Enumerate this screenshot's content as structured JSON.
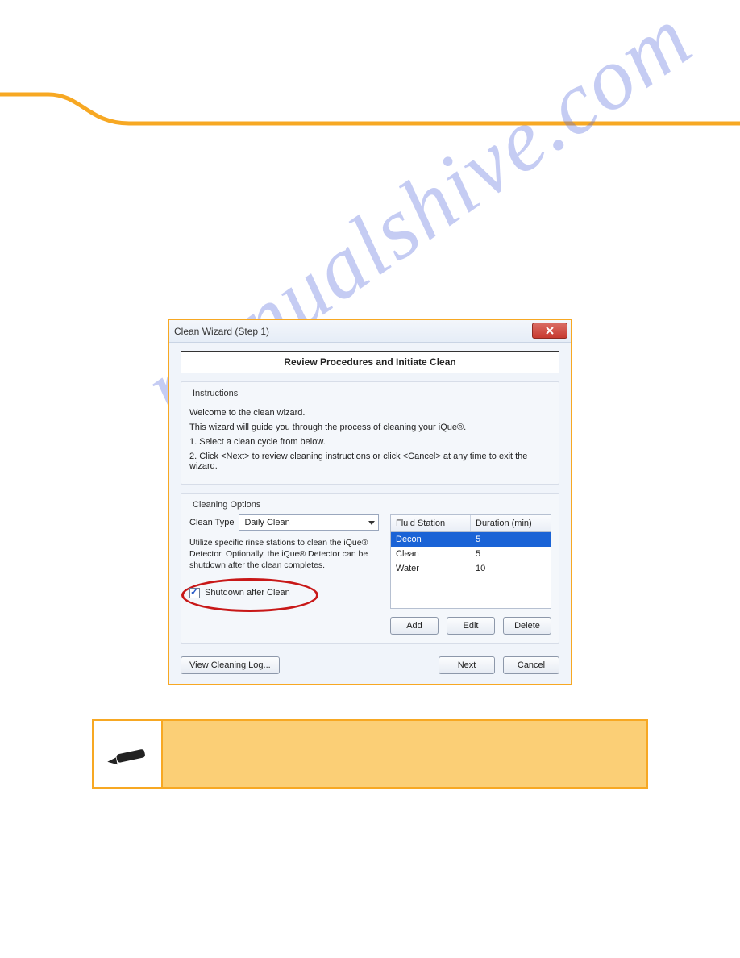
{
  "dialog": {
    "title": "Clean Wizard (Step 1)",
    "section_title": "Review Procedures and Initiate Clean",
    "instructions": {
      "legend": "Instructions",
      "welcome": "Welcome to the clean wizard.",
      "guide": "This wizard will guide you through the process of cleaning your iQue®.",
      "step1": "1.  Select a clean cycle from below.",
      "step2": "2.  Click <Next> to review cleaning instructions or click <Cancel> at any time to exit the wizard."
    },
    "cleaning_options": {
      "legend": "Cleaning Options",
      "clean_type_label": "Clean Type",
      "clean_type_value": "Daily Clean",
      "description": "Utilize specific rinse stations to clean the iQue® Detector. Optionally, the iQue® Detector can be shutdown after the clean completes.",
      "shutdown_label": "Shutdown after Clean"
    },
    "table": {
      "headers": {
        "col1": "Fluid Station",
        "col2": "Duration (min)"
      },
      "rows": [
        {
          "station": "Decon",
          "duration": "5"
        },
        {
          "station": "Clean",
          "duration": "5"
        },
        {
          "station": "Water",
          "duration": "10"
        }
      ]
    },
    "buttons": {
      "add": "Add",
      "edit": "Edit",
      "delete": "Delete",
      "view_log": "View Cleaning Log...",
      "next": "Next",
      "cancel": "Cancel"
    }
  },
  "watermark": "manualshive.com"
}
